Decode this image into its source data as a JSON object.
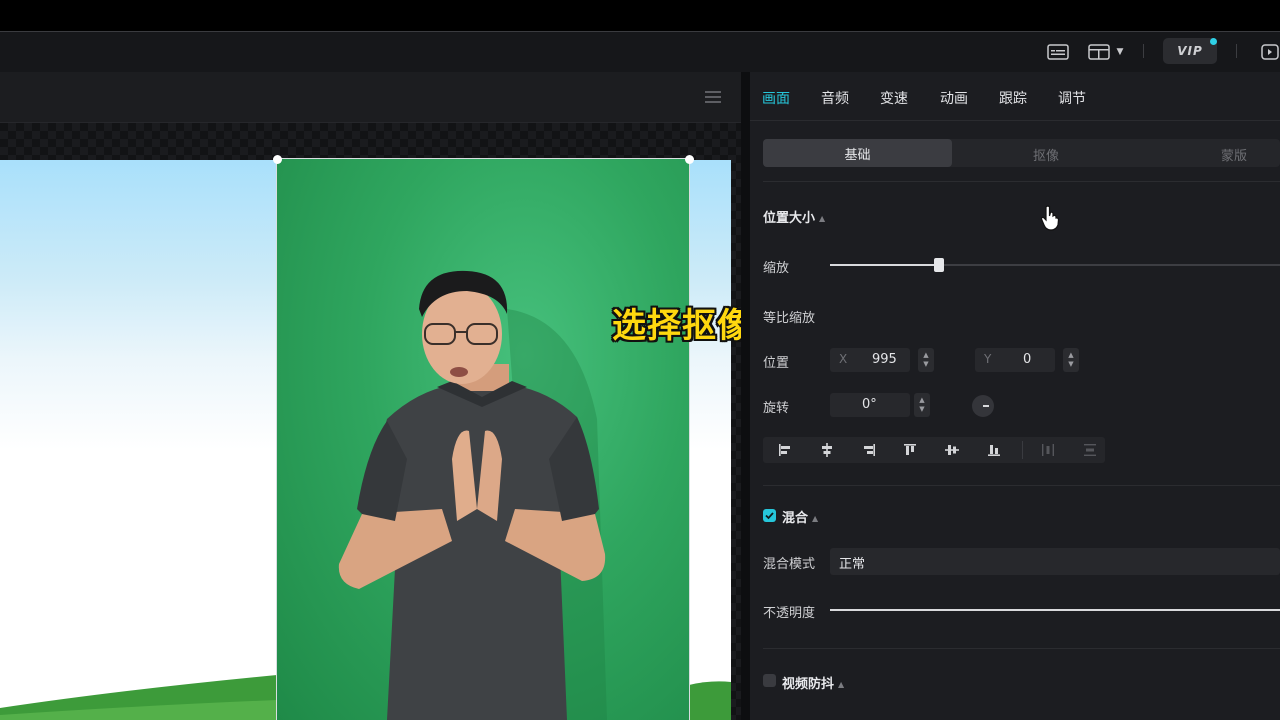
{
  "caption": "选择抠像",
  "header": {
    "vip_label": "VIP",
    "icons": [
      "subtitle-icon",
      "layout-icon",
      "chevron-down-icon",
      "export-icon"
    ]
  },
  "tabs": [
    {
      "label": "画面",
      "active": true
    },
    {
      "label": "音频",
      "active": false
    },
    {
      "label": "变速",
      "active": false
    },
    {
      "label": "动画",
      "active": false
    },
    {
      "label": "跟踪",
      "active": false
    },
    {
      "label": "调节",
      "active": false
    }
  ],
  "subtabs": [
    {
      "label": "基础",
      "active": true
    },
    {
      "label": "抠像",
      "active": false
    },
    {
      "label": "蒙版",
      "active": false
    }
  ],
  "position_size": {
    "section_title": "位置大小",
    "scale_label": "缩放",
    "scale_value": 0.33,
    "uniform_scale_label": "等比缩放",
    "position_label": "位置",
    "x_prefix": "X",
    "x_value": "995",
    "y_prefix": "Y",
    "y_value": "0",
    "rotation_label": "旋转",
    "rotation_value": "0°"
  },
  "blend": {
    "section_title": "混合",
    "enabled": true,
    "mode_label": "混合模式",
    "mode_value": "正常",
    "opacity_label": "不透明度",
    "opacity_value": 1.0
  },
  "stabilize": {
    "section_title": "视频防抖",
    "enabled": false
  },
  "colors": {
    "accent": "#26c6da",
    "caption_text": "#ffd80f"
  }
}
